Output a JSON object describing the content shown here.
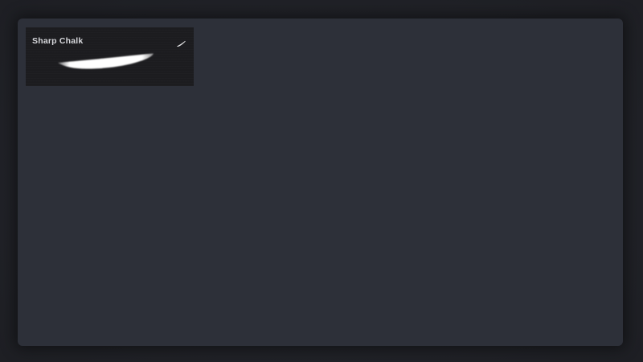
{
  "brush_library": {
    "brushes": [
      {
        "name": "Sharp Chalk",
        "icon": "brush-stroke-icon",
        "selected": false
      }
    ]
  },
  "colors": {
    "background": "#1f2026",
    "panel": "#2d3039",
    "card": "#1c1c1f",
    "label": "#d7d8dc",
    "stroke": "#ffffff"
  }
}
